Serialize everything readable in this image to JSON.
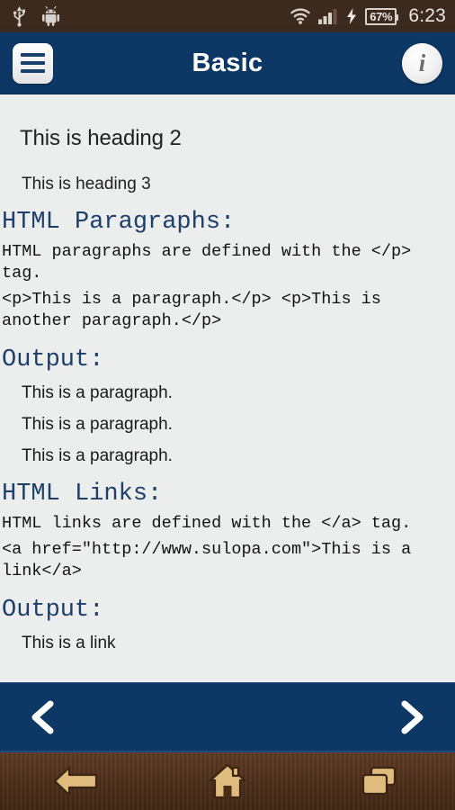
{
  "status_bar": {
    "left_icons": [
      "usb-icon",
      "android-robot-icon"
    ],
    "wifi_icon": "wifi-icon",
    "signal_icon": "cellular-signal-icon",
    "charging_icon": "charging-bolt-icon",
    "battery_level": "67%",
    "clock": "6:23",
    "background_color": "#3d2a1e",
    "foreground_color": "#d8d2cc"
  },
  "app_bar": {
    "menu_icon": "hamburger-menu-icon",
    "title": "Basic",
    "info_icon": "i",
    "background_color": "#0d3866",
    "title_color": "#ffffff"
  },
  "content": {
    "clipped_top_text": "-",
    "heading2": "This is heading 2",
    "heading3": "This is heading 3",
    "sections": [
      {
        "title": "HTML Paragraphs:",
        "description": "HTML paragraphs are defined with the </p> tag.",
        "code": "<p>This is a paragraph.</p> <p>This is another paragraph.</p>",
        "output_title": "Output:",
        "output_lines": [
          "This is a paragraph.",
          "This is a paragraph.",
          "This is a paragraph."
        ]
      },
      {
        "title": "HTML Links:",
        "description": "HTML links are defined with the </a> tag.",
        "code": "<a href=\"http://www.sulopa.com\">This is a link</a>",
        "output_title": "Output:",
        "output_lines": [
          "This is a link"
        ]
      }
    ],
    "background_color": "#eceded",
    "heading_color": "#1d3f69",
    "body_text_color": "#131313"
  },
  "pager": {
    "prev_icon": "chevron-left-icon",
    "next_icon": "chevron-right-icon",
    "background_color": "#0d3866"
  },
  "android_nav": {
    "back_icon": "back-arrow-icon",
    "home_icon": "home-icon",
    "recents_icon": "recent-apps-icon",
    "icon_color": "#e0bb7e",
    "background_color": "#4a2d18"
  }
}
